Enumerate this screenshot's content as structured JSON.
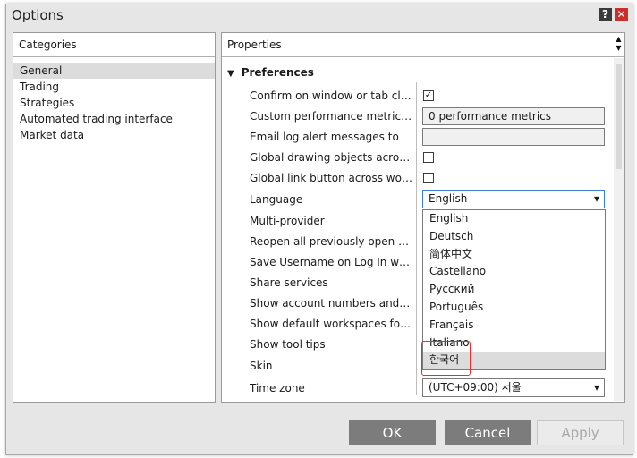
{
  "window": {
    "title": "Options"
  },
  "categories": {
    "header": "Categories",
    "items": [
      "General",
      "Trading",
      "Strategies",
      "Automated trading interface",
      "Market data"
    ],
    "selected": "General"
  },
  "properties": {
    "header": "Properties",
    "section": "Preferences",
    "rows": [
      {
        "label": "Confirm on window or tab close",
        "control": "checkbox",
        "checked": true
      },
      {
        "label": "Custom performance metric(s)",
        "control": "text",
        "value": "0 performance metrics"
      },
      {
        "label": "Email log alert messages to",
        "control": "text",
        "value": ""
      },
      {
        "label": "Global drawing objects across w...",
        "control": "checkbox",
        "checked": false
      },
      {
        "label": "Global link button across works...",
        "control": "checkbox",
        "checked": false
      },
      {
        "label": "Language",
        "control": "select",
        "value": "English"
      },
      {
        "label": "Multi-provider"
      },
      {
        "label": "Reopen all previously open work..."
      },
      {
        "label": "Save Username on Log In window"
      },
      {
        "label": "Share services"
      },
      {
        "label": "Show account numbers and bal..."
      },
      {
        "label": "Show default workspaces folder"
      },
      {
        "label": "Show tool tips"
      },
      {
        "label": "Skin"
      },
      {
        "label": "Time zone",
        "control": "select",
        "value": "(UTC+09:00) 서울"
      }
    ]
  },
  "language_dropdown": {
    "options": [
      "English",
      "Deutsch",
      "简体中文",
      "Castellano",
      "Русский",
      "Português",
      "Français",
      "Italiano",
      "한국어"
    ],
    "highlighted": "한국어"
  },
  "buttons": {
    "ok": "OK",
    "cancel": "Cancel",
    "apply": "Apply"
  },
  "icons": {
    "help": "?",
    "close": "✕",
    "check": "✓",
    "chevron": "⌄"
  },
  "colors": {
    "close_red": "#c9302c",
    "focus_blue": "#3c7fd6",
    "annotation_red": "#e53030"
  }
}
